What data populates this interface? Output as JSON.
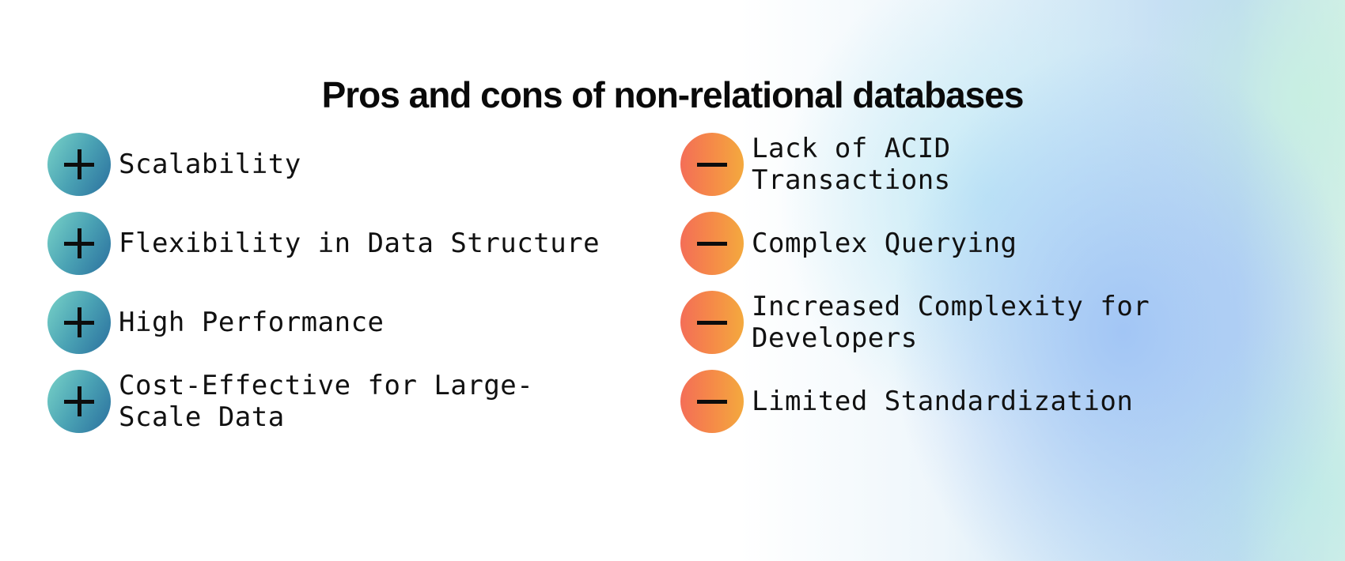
{
  "title": "Pros and cons of non-relational databases",
  "pros": {
    "icon": "plus-icon",
    "items": [
      {
        "label": "Scalability"
      },
      {
        "label": "Flexibility in Data Structure"
      },
      {
        "label": "High Performance"
      },
      {
        "label": "Cost-Effective for Large-\nScale Data"
      }
    ]
  },
  "cons": {
    "icon": "minus-icon",
    "items": [
      {
        "label": "Lack of ACID\nTransactions"
      },
      {
        "label": "Complex Querying"
      },
      {
        "label": "Increased Complexity for\nDevelopers"
      },
      {
        "label": "Limited Standardization"
      }
    ]
  },
  "colors": {
    "pros_badge": [
      "#79d3c8",
      "#2a6f9e"
    ],
    "cons_badge": [
      "#f46e57",
      "#f4a93e"
    ],
    "text": "#111111"
  }
}
